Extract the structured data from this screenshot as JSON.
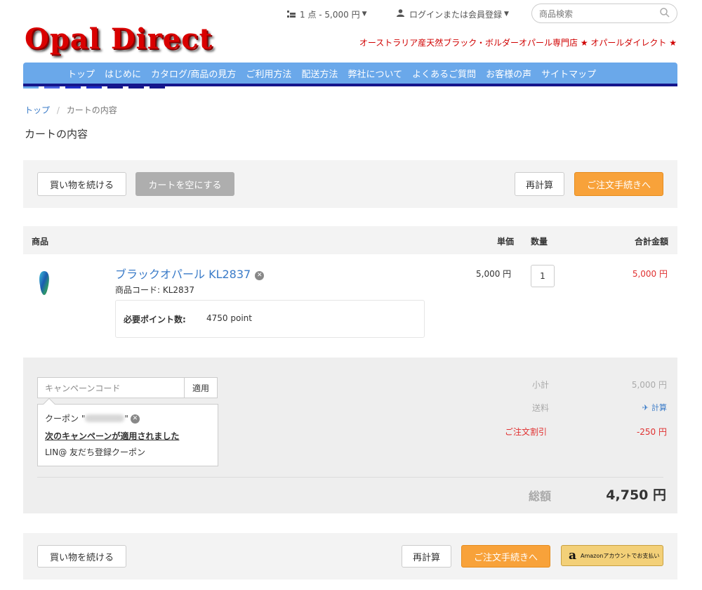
{
  "header": {
    "logo": "Opal Direct",
    "cart_summary": "1 点 - 5,000 円",
    "login": "ログインまたは会員登録",
    "search_placeholder": "商品検索",
    "tagline": "オーストラリア産天然ブラック・ボルダーオパール専門店 ★ オパールダイレクト ★"
  },
  "nav": {
    "items": [
      "トップ",
      "はじめに",
      "カタログ/商品の見方",
      "ご利用方法",
      "配送方法",
      "弊社について",
      "よくあるご質問",
      "お客様の声",
      "サイトマップ"
    ],
    "dash_colors": [
      "#6aa8ea",
      "#4a62e0",
      "#1f2ec8",
      "#1f2ec8",
      "#15168c",
      "#15168c",
      "#15168c"
    ]
  },
  "breadcrumb": {
    "home": "トップ",
    "separator": "/",
    "current": "カートの内容"
  },
  "page_title": "カートの内容",
  "top_actions": {
    "continue": "買い物を続ける",
    "empty_cart": "カートを空にする",
    "recalc": "再計算",
    "checkout": "ご注文手続きへ"
  },
  "table": {
    "headers": {
      "product": "商品",
      "unit_price": "単価",
      "quantity": "数量",
      "total": "合計金額"
    },
    "items": [
      {
        "name": "ブラックオパール KL2837",
        "code": "商品コード: KL2837",
        "points_label": "必要ポイント数:",
        "points_value": "4750 point",
        "unit_price": "5,000 円",
        "quantity": "1",
        "total": "5,000 円"
      }
    ]
  },
  "campaign": {
    "placeholder": "キャンペーンコード",
    "apply": "適用",
    "coupon_prefix": "クーポン \"",
    "coupon_suffix": "\"",
    "applied_title": "次のキャンペーンが適用されました",
    "campaign_name": "LIN@ 友だち登録クーポン"
  },
  "summary": {
    "subtotal_label": "小計",
    "subtotal": "5,000 円",
    "shipping_label": "送料",
    "shipping_action": "計算",
    "discount_label": "ご注文割引",
    "discount": "-250 円",
    "grand_label": "総額",
    "grand_total": "4,750 円"
  },
  "bottom_actions": {
    "continue": "買い物を続ける",
    "recalc": "再計算",
    "checkout": "ご注文手続きへ",
    "amazon": "Amazonアカウントでお支払い"
  },
  "colors": {
    "accent_blue": "#3a7bc8",
    "nav_blue": "#6aa8ea",
    "orange": "#f8a23a",
    "price_red": "#e03030"
  }
}
